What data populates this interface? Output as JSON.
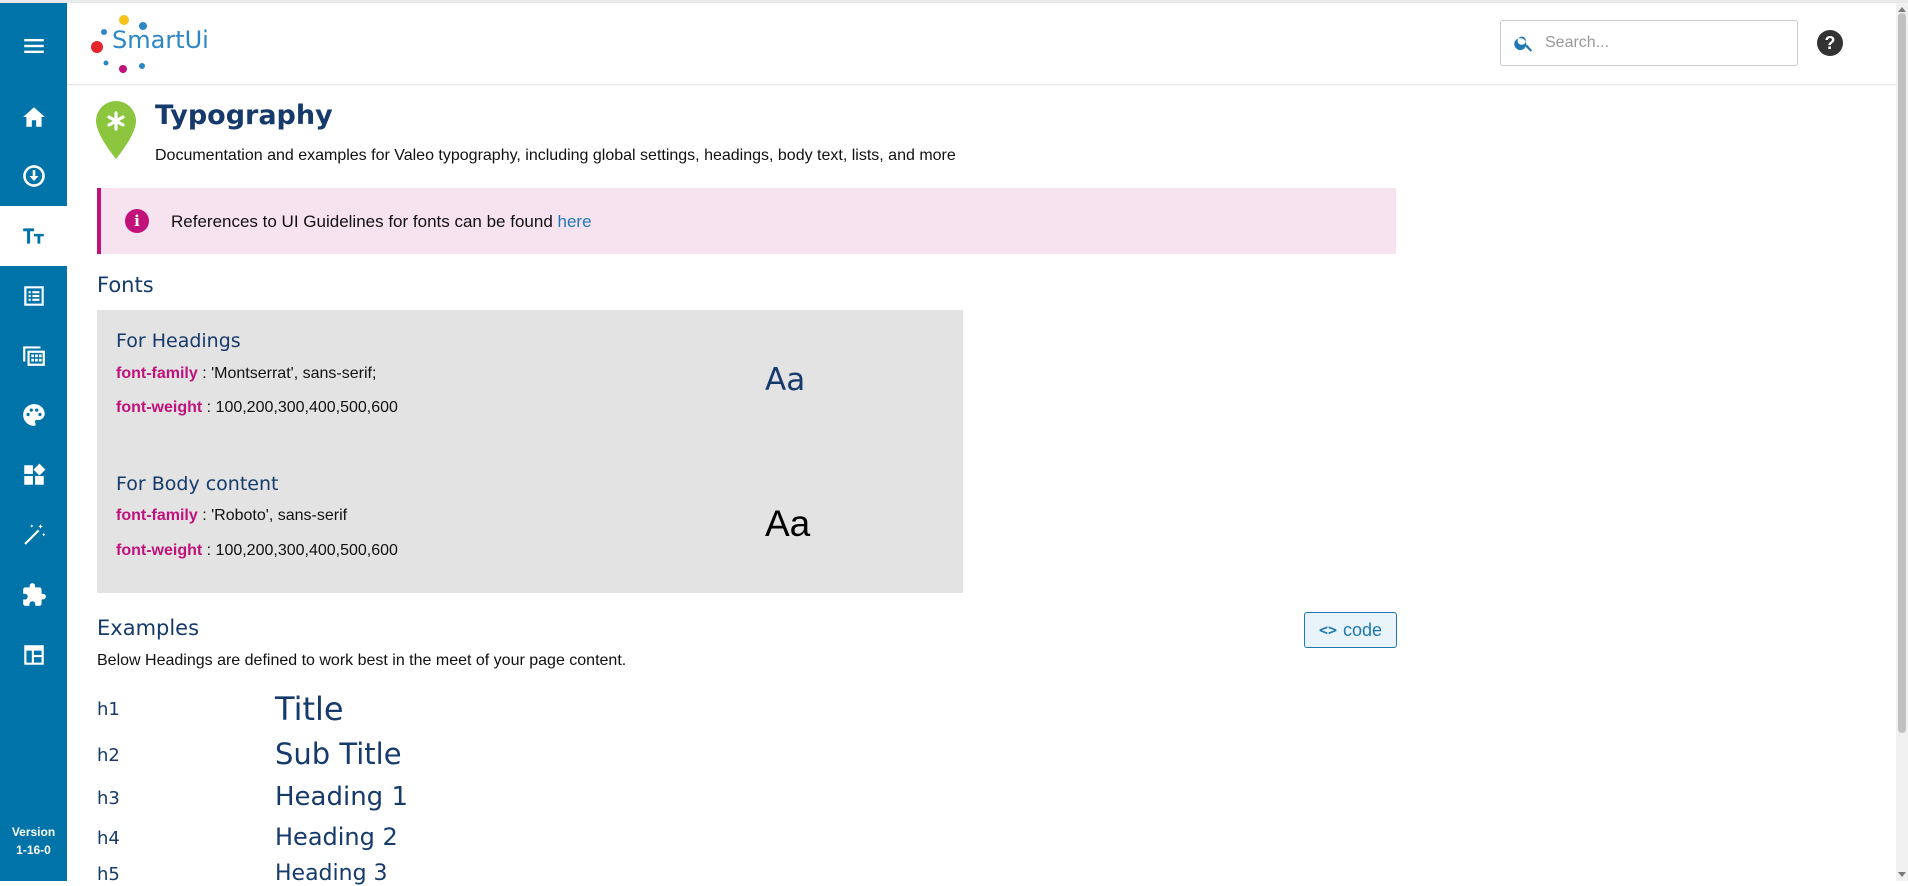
{
  "app": {
    "logo_text": "SmartUi",
    "version_label": "Version",
    "version_number": "1-16-0"
  },
  "sidebar": {
    "items": [
      {
        "name": "menu",
        "icon": "hamburger-icon"
      },
      {
        "name": "home",
        "icon": "home-icon"
      },
      {
        "name": "installation",
        "icon": "download-circle-icon"
      },
      {
        "name": "typography",
        "icon": "text-size-icon",
        "active": true
      },
      {
        "name": "lists",
        "icon": "list-icon"
      },
      {
        "name": "calendar",
        "icon": "calendar-grid-icon"
      },
      {
        "name": "colors",
        "icon": "palette-icon"
      },
      {
        "name": "widgets",
        "icon": "widgets-icon"
      },
      {
        "name": "magic",
        "icon": "magic-wand-icon"
      },
      {
        "name": "plugins",
        "icon": "puzzle-icon"
      },
      {
        "name": "layout",
        "icon": "table-layout-icon"
      }
    ]
  },
  "header": {
    "search_placeholder": "Search...",
    "help_glyph": "?"
  },
  "page": {
    "title": "Typography",
    "subtitle": "Documentation and examples for Valeo typography, including global settings, headings, body text, lists, and more"
  },
  "alert": {
    "text": "References to UI Guidelines for fonts can be found ",
    "link": "here"
  },
  "fonts": {
    "section_title": "Fonts",
    "headings": {
      "title": "For Headings",
      "family_key": "font-family",
      "family_value": " : 'Montserrat', sans-serif;",
      "weight_key": "font-weight",
      "weight_value": " : 100,200,300,400,500,600",
      "sample": "Aa"
    },
    "body": {
      "title": "For Body content",
      "family_key": "font-family",
      "family_value": " : 'Roboto', sans-serif",
      "weight_key": "font-weight",
      "weight_value": " : 100,200,300,400,500,600",
      "sample": "Aa"
    }
  },
  "examples": {
    "section_title": "Examples",
    "code_button": "code",
    "subtitle": "Below Headings are defined to work best in the meet of your page content.",
    "rows": [
      {
        "tag": "h1",
        "text": "Title"
      },
      {
        "tag": "h2",
        "text": "Sub Title"
      },
      {
        "tag": "h3",
        "text": "Heading 1"
      },
      {
        "tag": "h4",
        "text": "Heading 2"
      },
      {
        "tag": "h5",
        "text": "Heading 3"
      }
    ]
  },
  "colors": {
    "sidebar": "#0073a8",
    "heading": "#153a6b",
    "accent_magenta": "#c0127a",
    "link": "#1f77b4",
    "alert_bg": "#f7e3ef",
    "fonts_box_bg": "#e3e3e3"
  }
}
